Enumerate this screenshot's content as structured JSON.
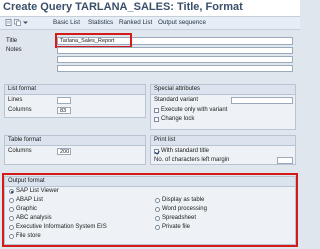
{
  "window": {
    "title": "Create Query TARLANA_SALES: Title, Format"
  },
  "toolbar": {
    "items": [
      "Basic List",
      "Statistics",
      "Ranked List",
      "Output sequence"
    ]
  },
  "header": {
    "title_label": "Title",
    "title_value": "Tarlana_Sales_Report",
    "notes_label": "Notes"
  },
  "list_format": {
    "heading": "List format",
    "lines_label": "Lines",
    "lines_value": "",
    "columns_label": "Columns",
    "columns_value": "83"
  },
  "special_attributes": {
    "heading": "Special attributes",
    "standard_variant_label": "Standard variant",
    "standard_variant_value": "",
    "execute_only_label": "Execute only with variant",
    "change_lock_label": "Change lock"
  },
  "table_format": {
    "heading": "Table format",
    "columns_label": "Columns",
    "columns_value": "200"
  },
  "print_list": {
    "heading": "Print list",
    "with_standard_title_label": "With standard title",
    "left_margin_label": "No. of characters left margin",
    "left_margin_value": ""
  },
  "output_format": {
    "heading": "Output format",
    "left_options": [
      "SAP List Viewer",
      "ABAP List",
      "Graphic",
      "ABC analysis",
      "Executive Information System EIS",
      "File store"
    ],
    "right_options": [
      "Display as table",
      "Word processing",
      "Spreadsheet",
      "Private file"
    ],
    "selected": "SAP List Viewer"
  },
  "colors": {
    "highlight": "#d51a1a",
    "title_text": "#3a4f6b"
  }
}
